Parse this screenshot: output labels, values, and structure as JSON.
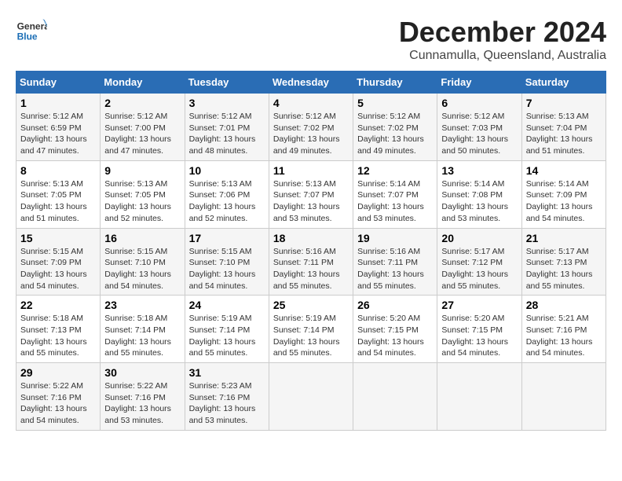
{
  "logo": {
    "line1": "General",
    "line2": "Blue"
  },
  "title": "December 2024",
  "subtitle": "Cunnamulla, Queensland, Australia",
  "headers": [
    "Sunday",
    "Monday",
    "Tuesday",
    "Wednesday",
    "Thursday",
    "Friday",
    "Saturday"
  ],
  "weeks": [
    [
      {
        "day": "1",
        "sunrise": "5:12 AM",
        "sunset": "6:59 PM",
        "daylight": "13 hours and 47 minutes."
      },
      {
        "day": "2",
        "sunrise": "5:12 AM",
        "sunset": "7:00 PM",
        "daylight": "13 hours and 47 minutes."
      },
      {
        "day": "3",
        "sunrise": "5:12 AM",
        "sunset": "7:01 PM",
        "daylight": "13 hours and 48 minutes."
      },
      {
        "day": "4",
        "sunrise": "5:12 AM",
        "sunset": "7:02 PM",
        "daylight": "13 hours and 49 minutes."
      },
      {
        "day": "5",
        "sunrise": "5:12 AM",
        "sunset": "7:02 PM",
        "daylight": "13 hours and 49 minutes."
      },
      {
        "day": "6",
        "sunrise": "5:12 AM",
        "sunset": "7:03 PM",
        "daylight": "13 hours and 50 minutes."
      },
      {
        "day": "7",
        "sunrise": "5:13 AM",
        "sunset": "7:04 PM",
        "daylight": "13 hours and 51 minutes."
      }
    ],
    [
      {
        "day": "8",
        "sunrise": "5:13 AM",
        "sunset": "7:05 PM",
        "daylight": "13 hours and 51 minutes."
      },
      {
        "day": "9",
        "sunrise": "5:13 AM",
        "sunset": "7:05 PM",
        "daylight": "13 hours and 52 minutes."
      },
      {
        "day": "10",
        "sunrise": "5:13 AM",
        "sunset": "7:06 PM",
        "daylight": "13 hours and 52 minutes."
      },
      {
        "day": "11",
        "sunrise": "5:13 AM",
        "sunset": "7:07 PM",
        "daylight": "13 hours and 53 minutes."
      },
      {
        "day": "12",
        "sunrise": "5:14 AM",
        "sunset": "7:07 PM",
        "daylight": "13 hours and 53 minutes."
      },
      {
        "day": "13",
        "sunrise": "5:14 AM",
        "sunset": "7:08 PM",
        "daylight": "13 hours and 53 minutes."
      },
      {
        "day": "14",
        "sunrise": "5:14 AM",
        "sunset": "7:09 PM",
        "daylight": "13 hours and 54 minutes."
      }
    ],
    [
      {
        "day": "15",
        "sunrise": "5:15 AM",
        "sunset": "7:09 PM",
        "daylight": "13 hours and 54 minutes."
      },
      {
        "day": "16",
        "sunrise": "5:15 AM",
        "sunset": "7:10 PM",
        "daylight": "13 hours and 54 minutes."
      },
      {
        "day": "17",
        "sunrise": "5:15 AM",
        "sunset": "7:10 PM",
        "daylight": "13 hours and 54 minutes."
      },
      {
        "day": "18",
        "sunrise": "5:16 AM",
        "sunset": "7:11 PM",
        "daylight": "13 hours and 55 minutes."
      },
      {
        "day": "19",
        "sunrise": "5:16 AM",
        "sunset": "7:11 PM",
        "daylight": "13 hours and 55 minutes."
      },
      {
        "day": "20",
        "sunrise": "5:17 AM",
        "sunset": "7:12 PM",
        "daylight": "13 hours and 55 minutes."
      },
      {
        "day": "21",
        "sunrise": "5:17 AM",
        "sunset": "7:13 PM",
        "daylight": "13 hours and 55 minutes."
      }
    ],
    [
      {
        "day": "22",
        "sunrise": "5:18 AM",
        "sunset": "7:13 PM",
        "daylight": "13 hours and 55 minutes."
      },
      {
        "day": "23",
        "sunrise": "5:18 AM",
        "sunset": "7:14 PM",
        "daylight": "13 hours and 55 minutes."
      },
      {
        "day": "24",
        "sunrise": "5:19 AM",
        "sunset": "7:14 PM",
        "daylight": "13 hours and 55 minutes."
      },
      {
        "day": "25",
        "sunrise": "5:19 AM",
        "sunset": "7:14 PM",
        "daylight": "13 hours and 55 minutes."
      },
      {
        "day": "26",
        "sunrise": "5:20 AM",
        "sunset": "7:15 PM",
        "daylight": "13 hours and 54 minutes."
      },
      {
        "day": "27",
        "sunrise": "5:20 AM",
        "sunset": "7:15 PM",
        "daylight": "13 hours and 54 minutes."
      },
      {
        "day": "28",
        "sunrise": "5:21 AM",
        "sunset": "7:16 PM",
        "daylight": "13 hours and 54 minutes."
      }
    ],
    [
      {
        "day": "29",
        "sunrise": "5:22 AM",
        "sunset": "7:16 PM",
        "daylight": "13 hours and 54 minutes."
      },
      {
        "day": "30",
        "sunrise": "5:22 AM",
        "sunset": "7:16 PM",
        "daylight": "13 hours and 53 minutes."
      },
      {
        "day": "31",
        "sunrise": "5:23 AM",
        "sunset": "7:16 PM",
        "daylight": "13 hours and 53 minutes."
      },
      null,
      null,
      null,
      null
    ]
  ],
  "labels": {
    "sunrise": "Sunrise:",
    "sunset": "Sunset:",
    "daylight": "Daylight:"
  }
}
